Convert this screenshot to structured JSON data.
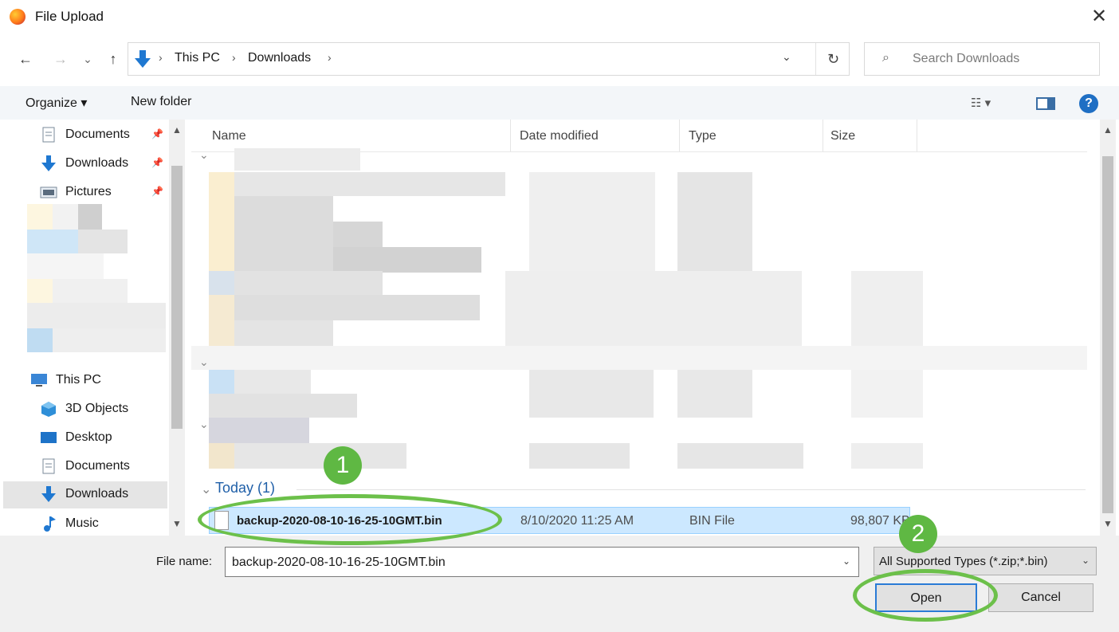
{
  "window": {
    "title": "File Upload",
    "close": "✕"
  },
  "nav": {
    "back": "←",
    "forward": "→",
    "recent": "⌄",
    "up": "↑",
    "crumbs": [
      "This PC",
      "Downloads"
    ],
    "crumb_sep": "›",
    "dropdown": "⌄",
    "refresh": "↻",
    "search_placeholder": "Search Downloads",
    "search_icon": "⌕"
  },
  "toolbar": {
    "organize": "Organize ▾",
    "new_folder": "New folder",
    "view": "☷ ▾",
    "help": "?"
  },
  "sidebar": {
    "quick": [
      {
        "label": "Documents",
        "icon": "documents-icon",
        "pinned": true
      },
      {
        "label": "Downloads",
        "icon": "downloads-icon",
        "pinned": true
      },
      {
        "label": "Pictures",
        "icon": "pictures-icon",
        "pinned": true
      }
    ],
    "this_pc": "This PC",
    "items": [
      {
        "label": "3D Objects",
        "icon": "3d-objects-icon"
      },
      {
        "label": "Desktop",
        "icon": "desktop-icon"
      },
      {
        "label": "Documents",
        "icon": "documents-icon"
      },
      {
        "label": "Downloads",
        "icon": "downloads-icon",
        "selected": true
      },
      {
        "label": "Music",
        "icon": "music-icon"
      }
    ],
    "pin": "📌"
  },
  "columns": [
    "Name",
    "Date modified",
    "Type",
    "Size"
  ],
  "group": {
    "title": "Today (1)",
    "toggle": "⌄"
  },
  "file": {
    "name": "backup-2020-08-10-16-25-10GMT.bin",
    "date": "8/10/2020 11:25 AM",
    "type": "BIN File",
    "size": "98,807 KB"
  },
  "bottom": {
    "filename_label": "File name:",
    "filename_value": "backup-2020-08-10-16-25-10GMT.bin",
    "filetype_value": "All Supported Types (*.zip;*.bin)",
    "open": "Open",
    "cancel": "Cancel"
  },
  "callouts": [
    "1",
    "2"
  ],
  "colors": {
    "accent": "#1f6fc4",
    "selection": "#cce8ff",
    "callout": "#5fb843"
  }
}
